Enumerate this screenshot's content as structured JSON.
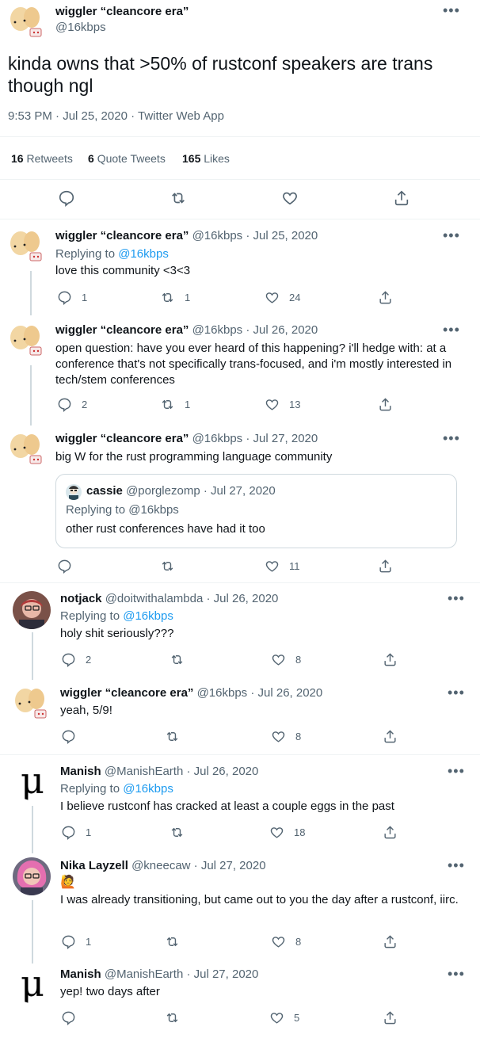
{
  "main": {
    "author_name": "wiggler “cleancore era”",
    "author_handle": "@16kbps",
    "text": "kinda owns that >50% of rustconf speakers are trans though ngl",
    "timestamp": "9:53 PM · Jul 25, 2020 · Twitter Web App",
    "stats": {
      "retweets_count": "16",
      "retweets_label": "Retweets",
      "quotes_count": "6",
      "quotes_label": "Quote Tweets",
      "likes_count": "165",
      "likes_label": "Likes"
    }
  },
  "replies": [
    {
      "name": "wiggler “cleancore era”",
      "meta": "@16kbps · Jul 25, 2020",
      "replying_label": "Replying to",
      "replying_handle": "@16kbps",
      "text": "love this community <3<3",
      "reply_count": "1",
      "retweet_count": "1",
      "like_count": "24"
    },
    {
      "name": "wiggler “cleancore era”",
      "meta": "@16kbps · Jul 26, 2020",
      "text": "open question: have you ever heard of this happening? i'll hedge with: at a conference that's not specifically trans-focused, and i'm mostly interested in tech/stem conferences",
      "reply_count": "2",
      "retweet_count": "1",
      "like_count": "13"
    },
    {
      "name": "wiggler “cleancore era”",
      "meta": "@16kbps · Jul 27, 2020",
      "text": "big W for the rust programming language community",
      "quote": {
        "name": "cassie",
        "meta": "@porglezomp · Jul 27, 2020",
        "replying": "Replying to @16kbps",
        "text": "other rust conferences have had it too"
      },
      "like_count": "11"
    },
    {
      "name": "notjack",
      "meta": "@doitwithalambda · Jul 26, 2020",
      "replying_label": "Replying to",
      "replying_handle": "@16kbps",
      "text": "holy shit seriously???",
      "reply_count": "2",
      "like_count": "8"
    },
    {
      "name": "wiggler “cleancore era”",
      "meta": "@16kbps · Jul 26, 2020",
      "text": "yeah, 5/9!",
      "like_count": "8"
    },
    {
      "name": "Manish",
      "meta": "@ManishEarth · Jul 26, 2020",
      "replying_label": "Replying to",
      "replying_handle": "@16kbps",
      "text": "I believe rustconf has cracked at least a couple eggs in the past",
      "reply_count": "1",
      "like_count": "18"
    },
    {
      "name": "Nika Layzell",
      "meta": "@kneecaw · Jul 27, 2020",
      "emoji": "🙋",
      "text": "I was already transitioning, but came out to you the day after a rustconf, iirc.",
      "reply_count": "1",
      "like_count": "8"
    },
    {
      "name": "Manish",
      "meta": "@ManishEarth · Jul 27, 2020",
      "text": "yep! two days after",
      "like_count": "5"
    }
  ],
  "avatars": {
    "manish_glyph": "μ"
  },
  "more_glyph": "•••",
  "colors": {
    "accent": "#1d9bf0",
    "secondary_text": "#536471",
    "border": "#eff3f4"
  }
}
